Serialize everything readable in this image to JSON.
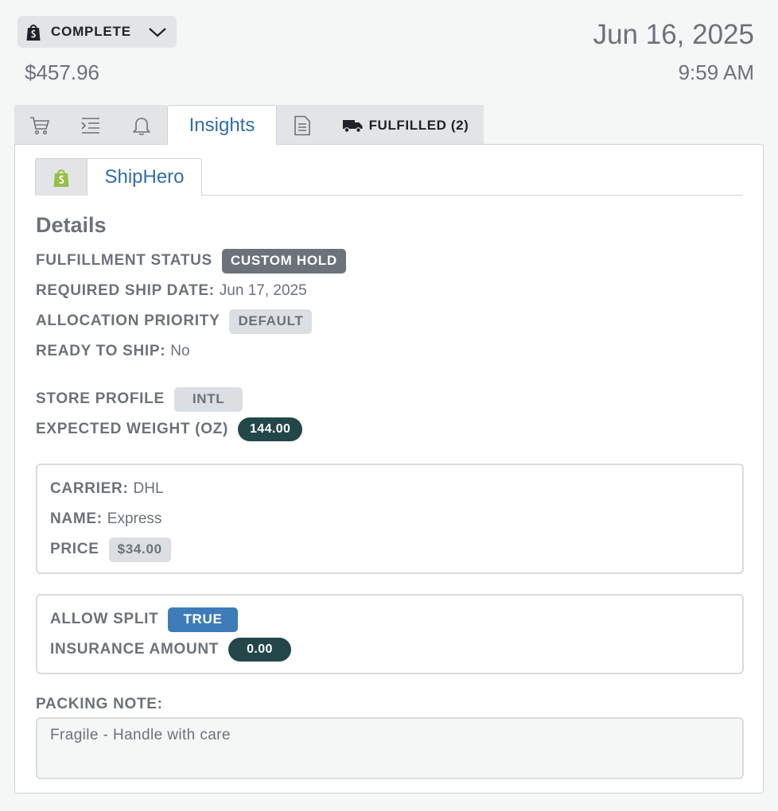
{
  "header": {
    "status_label": "COMPLETE",
    "total": "$457.96",
    "date": "Jun 16, 2025",
    "time": "9:59 AM"
  },
  "tabs": {
    "icons": [
      "cart-icon",
      "indent-list-icon",
      "bell-icon"
    ],
    "active_label": "Insights",
    "document_icon": "document-icon",
    "fulfilled_label": "FULFILLED (2)"
  },
  "subtabs": {
    "shop_icon": "shopify-bag-icon",
    "active_label": "ShipHero"
  },
  "details": {
    "heading": "Details",
    "fulfillment_status_label": "FULFILLMENT STATUS",
    "fulfillment_status_value": "CUSTOM HOLD",
    "required_ship_date_label": "REQUIRED SHIP DATE:",
    "required_ship_date_value": "Jun 17, 2025",
    "allocation_priority_label": "ALLOCATION PRIORITY",
    "allocation_priority_value": "DEFAULT",
    "ready_to_ship_label": "READY TO SHIP:",
    "ready_to_ship_value": "No",
    "store_profile_label": "STORE PROFILE",
    "store_profile_value": "INTL",
    "expected_weight_label": "EXPECTED WEIGHT (OZ)",
    "expected_weight_value": "144.00"
  },
  "shipping": {
    "carrier_label": "CARRIER:",
    "carrier_value": "DHL",
    "name_label": "NAME:",
    "name_value": "Express",
    "price_label": "PRICE",
    "price_value": "$34.00"
  },
  "options": {
    "allow_split_label": "ALLOW SPLIT",
    "allow_split_value": "TRUE",
    "insurance_label": "INSURANCE AMOUNT",
    "insurance_value": "0.00"
  },
  "packing": {
    "label": "PACKING NOTE:",
    "value": "Fragile - Handle with care"
  },
  "colors": {
    "accent_blue": "#2f6ea8",
    "shopify_green": "#95bf47",
    "pill_dark": "#234748",
    "badge_blue": "#3d7cb8"
  }
}
